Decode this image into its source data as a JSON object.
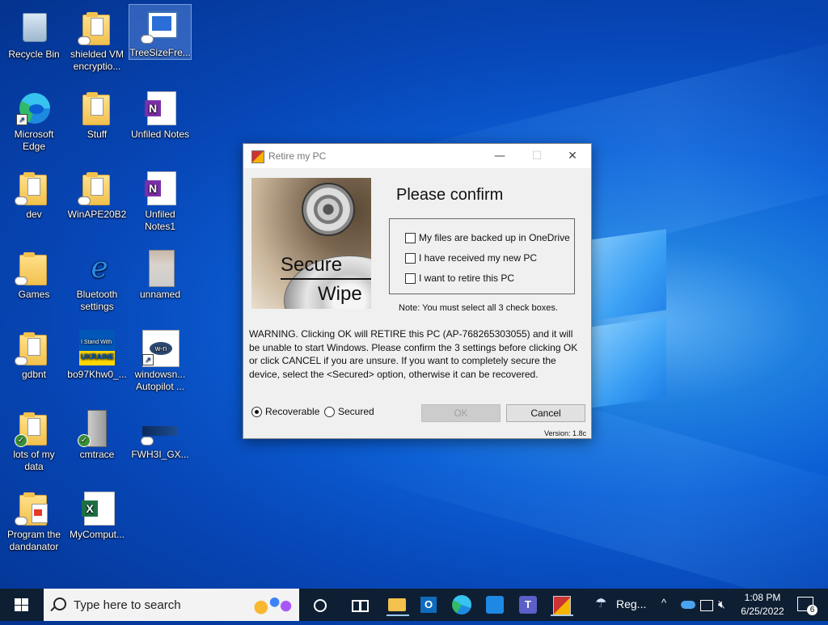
{
  "desktop": {
    "icons": [
      {
        "label": "Recycle Bin"
      },
      {
        "label": "shielded VM encryptio..."
      },
      {
        "label": "TreeSizeFre..."
      },
      {
        "label": "Microsoft Edge"
      },
      {
        "label": "Stuff"
      },
      {
        "label": "Unfiled Notes"
      },
      {
        "label": "dev"
      },
      {
        "label": "WinAPE20B2"
      },
      {
        "label": "Unfiled Notes1"
      },
      {
        "label": "Games"
      },
      {
        "label": "Bluetooth settings"
      },
      {
        "label": "unnamed"
      },
      {
        "label": "gdbnt"
      },
      {
        "label": "bo97Khw0_..."
      },
      {
        "label": "windowsn... Autopilot ..."
      },
      {
        "label": "lots of my data"
      },
      {
        "label": "cmtrace"
      },
      {
        "label": "FWH3I_GX..."
      },
      {
        "label": "Program the dandanator"
      },
      {
        "label": "MyComput..."
      }
    ],
    "ukraine_badge": {
      "line1": "I Stand With",
      "line2": "UKRAINE"
    },
    "ie_glyph": "e",
    "onenote_glyph": "N",
    "excel_glyph": "X"
  },
  "dialog": {
    "title": "Retire my PC",
    "minimize_glyph": "—",
    "maximize_glyph": "☐",
    "close_glyph": "✕",
    "hero": {
      "word1": "Secure",
      "word2": "Wipe"
    },
    "heading": "Please confirm",
    "checkboxes": [
      {
        "label": "My files are backed up in OneDrive",
        "checked": false
      },
      {
        "label": "I have received my new PC",
        "checked": false
      },
      {
        "label": "I want to retire this PC",
        "checked": false
      }
    ],
    "note": "Note: You must select all 3 check boxes.",
    "warning": "WARNING. Clicking OK will RETIRE this PC (AP-768265303055) and it will be unable to start Windows. Please confirm the 3 settings before clicking OK or click CANCEL if you are unsure. If you want to completely secure the device, select the <Secured> option, otherwise it can be recovered.",
    "radios": [
      {
        "label": "Recoverable",
        "selected": true
      },
      {
        "label": "Secured",
        "selected": false
      }
    ],
    "ok_label": "OK",
    "cancel_label": "Cancel",
    "version": "Version: 1.8c"
  },
  "taskbar": {
    "search_placeholder": "Type here to search",
    "weather_text": "Reg...",
    "weather_icon": "umbrella-icon",
    "tray_chevron": "^",
    "time": "1:08 PM",
    "date": "6/25/2022",
    "notification_count": "6",
    "pinned": [
      "cortana-icon",
      "task-view-icon",
      "file-explorer-icon",
      "outlook-icon",
      "edge-icon",
      "company-portal-icon",
      "teams-icon",
      "retire-app-icon"
    ]
  },
  "colors": {
    "desktop_accent": "#0b5ed4",
    "taskbar_bg": "#0e1f33",
    "dialog_bg": "#f0f0f0"
  }
}
